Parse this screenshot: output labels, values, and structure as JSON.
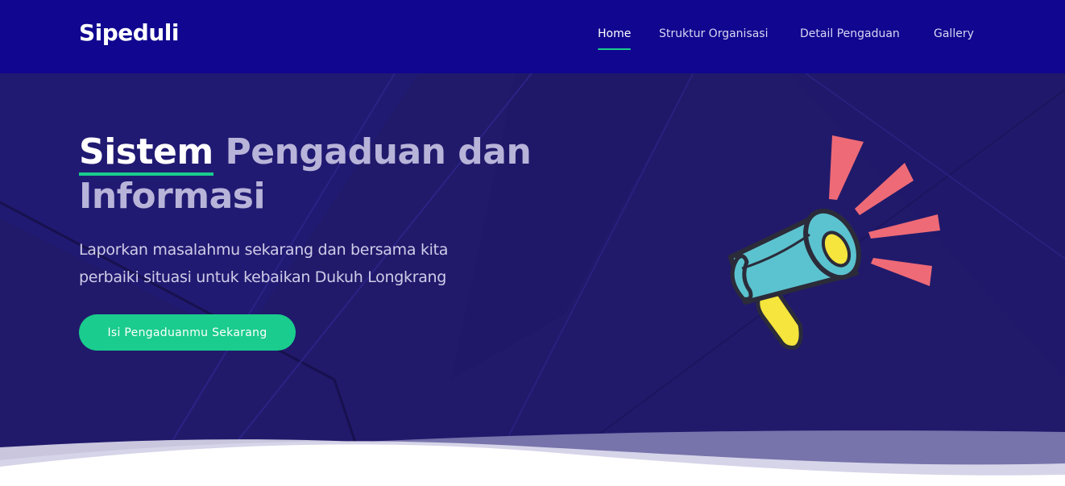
{
  "header": {
    "brand": "Sipeduli",
    "nav": [
      {
        "label": "Home",
        "active": true
      },
      {
        "label": "Struktur Organisasi",
        "active": false
      },
      {
        "label": "Detail Pengaduan",
        "active": false
      },
      {
        "label": "Gallery",
        "active": false
      }
    ]
  },
  "hero": {
    "title_highlight": "Sistem",
    "title_rest": "Pengaduan dan Informasi",
    "subtitle": "Laporkan masalahmu sekarang dan bersama kita perbaiki situasi untuk kebaikan Dukuh Longkrang",
    "cta_label": "Isi Pengaduanmu Sekarang",
    "illustration": "megaphone-icon"
  },
  "colors": {
    "navbar": "#10068f",
    "hero_background": "#211a6b",
    "accent": "#1acc8d",
    "megaphone_body": "#5bc3cf",
    "megaphone_rays": "#ee6a76",
    "megaphone_handle": "#f5e53c"
  }
}
